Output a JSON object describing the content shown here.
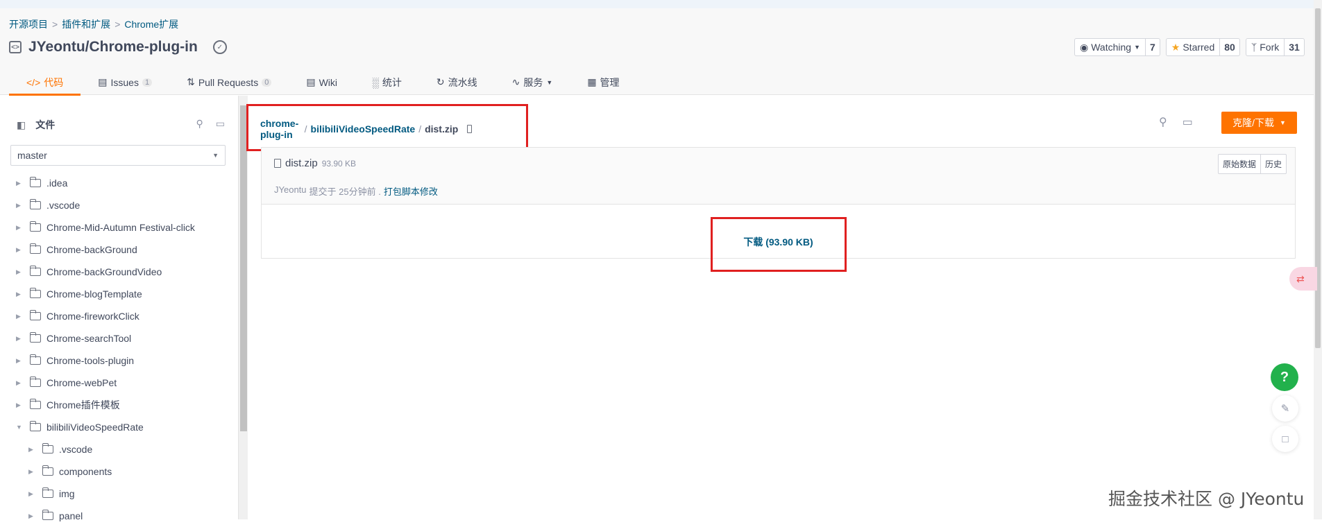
{
  "breadcrumb": {
    "root": "开源项目",
    "sep1": ">",
    "category": "插件和扩展",
    "sep2": ">",
    "sub": "Chrome扩展"
  },
  "repo": {
    "name": "JYeontu/Chrome-plug-in"
  },
  "actions": {
    "watching_label": "Watching",
    "watching_count": "7",
    "starred_label": "Starred",
    "starred_count": "80",
    "fork_label": "Fork",
    "fork_count": "31"
  },
  "tabs": [
    {
      "label": "代码"
    },
    {
      "label": "Issues",
      "count": "1"
    },
    {
      "label": "Pull Requests",
      "count": "0"
    },
    {
      "label": "Wiki"
    },
    {
      "label": "统计"
    },
    {
      "label": "流水线"
    },
    {
      "label": "服务"
    },
    {
      "label": "管理"
    }
  ],
  "sidebar": {
    "title": "文件",
    "branch": "master",
    "tree": [
      {
        "label": ".idea",
        "expanded": false,
        "depth": 0
      },
      {
        "label": ".vscode",
        "expanded": false,
        "depth": 0
      },
      {
        "label": "Chrome-Mid-Autumn Festival-click",
        "expanded": false,
        "depth": 0
      },
      {
        "label": "Chrome-backGround",
        "expanded": false,
        "depth": 0
      },
      {
        "label": "Chrome-backGroundVideo",
        "expanded": false,
        "depth": 0
      },
      {
        "label": "Chrome-blogTemplate",
        "expanded": false,
        "depth": 0
      },
      {
        "label": "Chrome-fireworkClick",
        "expanded": false,
        "depth": 0
      },
      {
        "label": "Chrome-searchTool",
        "expanded": false,
        "depth": 0
      },
      {
        "label": "Chrome-tools-plugin",
        "expanded": false,
        "depth": 0
      },
      {
        "label": "Chrome-webPet",
        "expanded": false,
        "depth": 0
      },
      {
        "label": "Chrome插件模板",
        "expanded": false,
        "depth": 0
      },
      {
        "label": "bilibiliVideoSpeedRate",
        "expanded": true,
        "depth": 0
      },
      {
        "label": ".vscode",
        "expanded": false,
        "depth": 1
      },
      {
        "label": "components",
        "expanded": false,
        "depth": 1
      },
      {
        "label": "img",
        "expanded": false,
        "depth": 1
      },
      {
        "label": "panel",
        "expanded": false,
        "depth": 1
      }
    ]
  },
  "path": {
    "root": "chrome-plug-in",
    "sep": "/",
    "folder": "bilibiliVideoSpeedRate",
    "file": "dist.zip"
  },
  "clone_button": "克隆/下载",
  "file": {
    "name": "dist.zip",
    "size": "93.90 KB",
    "raw_label": "原始数据",
    "history_label": "历史",
    "commit_author": "JYeontu",
    "commit_text": "提交于 25分钟前 .",
    "commit_message": "打包脚本修改",
    "download_label": "下载 (93.90 KB)"
  },
  "watermark": "掘金技术社区 @ JYeontu",
  "colors": {
    "accent": "#fe7300",
    "link": "#005980",
    "highlight_box": "#e02020",
    "help": "#22b14c"
  }
}
